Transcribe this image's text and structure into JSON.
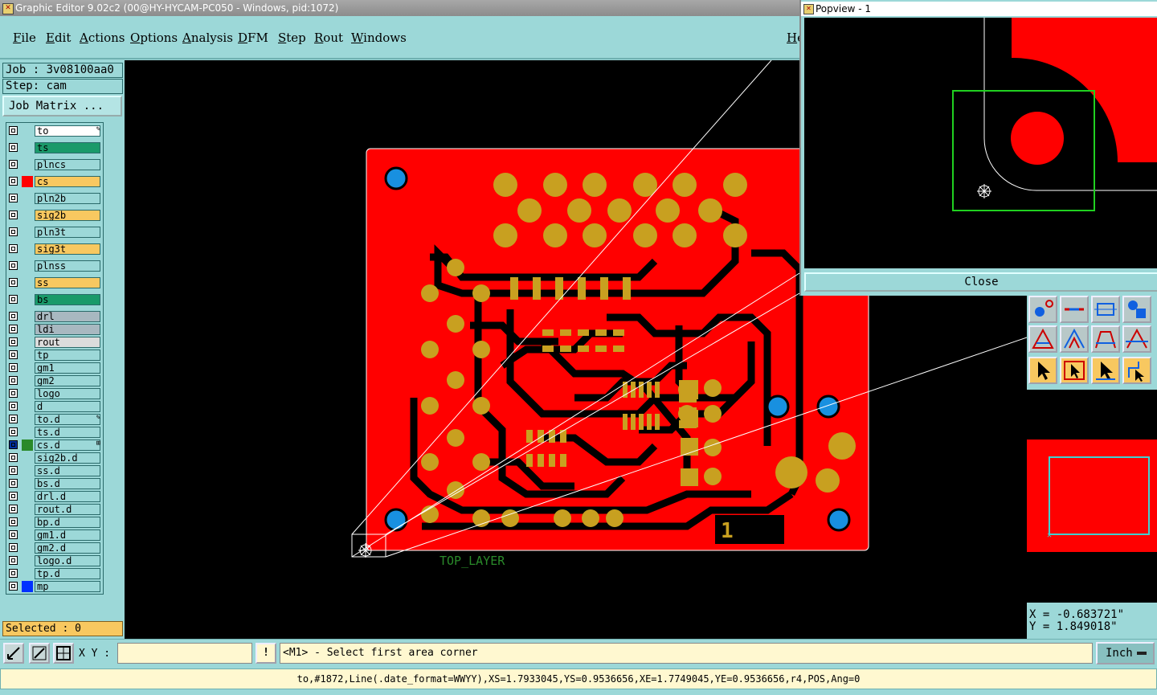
{
  "window": {
    "title": "Graphic Editor 9.02c2 (00@HY-HYCAM-PC050 - Windows, pid:1072)"
  },
  "menu": {
    "items": [
      "File",
      "Edit",
      "Actions",
      "Options",
      "Analysis",
      "DFM",
      "Step",
      "Rout",
      "Windows"
    ],
    "help": "He"
  },
  "job": {
    "label": "Job : 3v08100aa0",
    "step": "Step: cam",
    "matrix_button": "Job Matrix ..."
  },
  "layers": [
    {
      "name": "to",
      "color": "#ffffff",
      "swatch": "",
      "mark": "✎"
    },
    {
      "name": "ts",
      "color": "#1a9a6a",
      "swatch": "",
      "mark": ""
    },
    {
      "name": "plncs",
      "color": "#9cd8d8",
      "swatch": "",
      "mark": ""
    },
    {
      "name": "cs",
      "color": "#f8c860",
      "swatch": "#ff0000",
      "mark": ""
    },
    {
      "name": "pln2b",
      "color": "#9cd8d8",
      "swatch": "",
      "mark": ""
    },
    {
      "name": "sig2b",
      "color": "#f8c860",
      "swatch": "",
      "mark": ""
    },
    {
      "name": "pln3t",
      "color": "#9cd8d8",
      "swatch": "",
      "mark": ""
    },
    {
      "name": "sig3t",
      "color": "#f8c860",
      "swatch": "",
      "mark": ""
    },
    {
      "name": "plnss",
      "color": "#9cd8d8",
      "swatch": "",
      "mark": ""
    },
    {
      "name": "ss",
      "color": "#f8c860",
      "swatch": "",
      "mark": ""
    },
    {
      "name": "bs",
      "color": "#1a9a6a",
      "swatch": "",
      "mark": ""
    },
    {
      "name": "drl",
      "color": "#a8b8c0",
      "swatch": "",
      "mark": ""
    },
    {
      "name": "ldi",
      "color": "#a8b8c0",
      "swatch": "",
      "mark": ""
    },
    {
      "name": "rout",
      "color": "#dcdcdc",
      "swatch": "",
      "mark": ""
    },
    {
      "name": "tp",
      "color": "#9cd8d8",
      "swatch": "",
      "mark": ""
    },
    {
      "name": "gm1",
      "color": "#9cd8d8",
      "swatch": "",
      "mark": ""
    },
    {
      "name": "gm2",
      "color": "#9cd8d8",
      "swatch": "",
      "mark": ""
    },
    {
      "name": "logo",
      "color": "#9cd8d8",
      "swatch": "",
      "mark": ""
    },
    {
      "name": "d",
      "color": "#9cd8d8",
      "swatch": "",
      "mark": ""
    },
    {
      "name": "to.d",
      "color": "#9cd8d8",
      "swatch": "",
      "mark": "✎"
    },
    {
      "name": "ts.d",
      "color": "#9cd8d8",
      "swatch": "",
      "mark": ""
    },
    {
      "name": "cs.d",
      "color": "#9cd8d8",
      "swatch": "#2a8a2a",
      "mark": "⊞"
    },
    {
      "name": "sig2b.d",
      "color": "#9cd8d8",
      "swatch": "",
      "mark": ""
    },
    {
      "name": "ss.d",
      "color": "#9cd8d8",
      "swatch": "",
      "mark": ""
    },
    {
      "name": "bs.d",
      "color": "#9cd8d8",
      "swatch": "",
      "mark": ""
    },
    {
      "name": "drl.d",
      "color": "#9cd8d8",
      "swatch": "",
      "mark": ""
    },
    {
      "name": "rout.d",
      "color": "#9cd8d8",
      "swatch": "",
      "mark": ""
    },
    {
      "name": "bp.d",
      "color": "#9cd8d8",
      "swatch": "",
      "mark": ""
    },
    {
      "name": "gm1.d",
      "color": "#9cd8d8",
      "swatch": "",
      "mark": ""
    },
    {
      "name": "gm2.d",
      "color": "#9cd8d8",
      "swatch": "",
      "mark": ""
    },
    {
      "name": "logo.d",
      "color": "#9cd8d8",
      "swatch": "",
      "mark": ""
    },
    {
      "name": "tp.d",
      "color": "#9cd8d8",
      "swatch": "",
      "mark": ""
    },
    {
      "name": "mp",
      "color": "#9cd8d8",
      "swatch": "#0030ff",
      "mark": ""
    }
  ],
  "selected": "Selected : 0",
  "board": {
    "layer_label": "TOP_LAYER",
    "badge": "1"
  },
  "popview": {
    "title": "Popview - 1",
    "close": "Close"
  },
  "coords": {
    "x": "X = -0.683721\"",
    "y": "Y = 1.849018\""
  },
  "xy": {
    "label": "X Y :",
    "value": ""
  },
  "prompt": "<M1> - Select first area corner",
  "units": "Inch",
  "status": "to,#1872,Line(.date_format=WWYY),XS=1.7933045,YS=0.9536656,XE=1.7749045,YE=0.9536656,r4,POS,Ang=0",
  "colors": {
    "copper": "#ff0000",
    "pad": "#c8a020",
    "via": "#1890e0",
    "bg": "#9cd8d8"
  }
}
